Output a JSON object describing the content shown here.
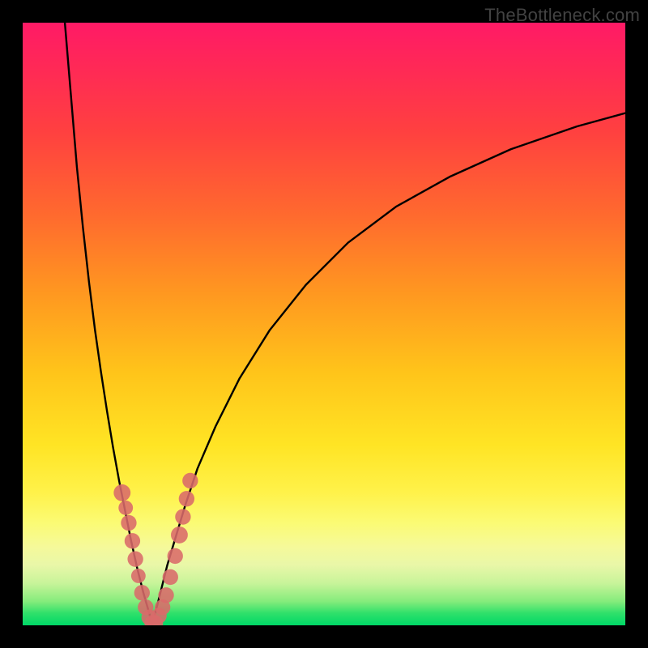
{
  "watermark": "TheBottleneck.com",
  "chart_data": {
    "type": "line",
    "title": "",
    "xlabel": "",
    "ylabel": "",
    "xlim": [
      0,
      100
    ],
    "ylim": [
      0,
      100
    ],
    "grid": false,
    "legend": false,
    "series": [
      {
        "name": "left-curve",
        "x": [
          7,
          8,
          9,
          10,
          11,
          12,
          13,
          14,
          15,
          16,
          17,
          18,
          19,
          20,
          21,
          21.5
        ],
        "values": [
          100,
          88,
          76,
          66,
          57,
          49,
          42,
          35.5,
          29.5,
          24,
          19,
          14,
          9.5,
          5.5,
          2,
          0
        ]
      },
      {
        "name": "right-curve",
        "x": [
          21.5,
          22,
          23,
          24,
          25.5,
          27,
          29,
          32,
          36,
          41,
          47,
          54,
          62,
          71,
          81,
          92,
          100
        ],
        "values": [
          0,
          2,
          6,
          10,
          15,
          20,
          26,
          33,
          41,
          49,
          56.5,
          63.5,
          69.5,
          74.5,
          79,
          82.8,
          85
        ]
      }
    ],
    "markers": {
      "name": "highlighted-points",
      "points": [
        {
          "x": 16.5,
          "y": 22,
          "r": 1.4
        },
        {
          "x": 17.1,
          "y": 19.5,
          "r": 1.2
        },
        {
          "x": 17.6,
          "y": 17,
          "r": 1.3
        },
        {
          "x": 18.2,
          "y": 14,
          "r": 1.3
        },
        {
          "x": 18.7,
          "y": 11,
          "r": 1.3
        },
        {
          "x": 19.2,
          "y": 8.2,
          "r": 1.2
        },
        {
          "x": 19.8,
          "y": 5.4,
          "r": 1.3
        },
        {
          "x": 20.4,
          "y": 3.0,
          "r": 1.3
        },
        {
          "x": 21.0,
          "y": 1.3,
          "r": 1.3
        },
        {
          "x": 21.5,
          "y": 0.4,
          "r": 1.3
        },
        {
          "x": 22.0,
          "y": 0.4,
          "r": 1.3
        },
        {
          "x": 22.6,
          "y": 1.6,
          "r": 1.3
        },
        {
          "x": 23.2,
          "y": 3.0,
          "r": 1.3
        },
        {
          "x": 23.8,
          "y": 5.0,
          "r": 1.3
        },
        {
          "x": 24.5,
          "y": 8.0,
          "r": 1.3
        },
        {
          "x": 25.3,
          "y": 11.5,
          "r": 1.3
        },
        {
          "x": 26.0,
          "y": 15.0,
          "r": 1.4
        },
        {
          "x": 26.6,
          "y": 18.0,
          "r": 1.3
        },
        {
          "x": 27.2,
          "y": 21.0,
          "r": 1.3
        },
        {
          "x": 27.8,
          "y": 24.0,
          "r": 1.3
        }
      ]
    },
    "background_gradient": {
      "stops": [
        {
          "pos": 0.0,
          "color": "#ff1a66"
        },
        {
          "pos": 0.18,
          "color": "#ff4040"
        },
        {
          "pos": 0.45,
          "color": "#ff9820"
        },
        {
          "pos": 0.7,
          "color": "#ffe424"
        },
        {
          "pos": 0.87,
          "color": "#f5f99a"
        },
        {
          "pos": 1.0,
          "color": "#00d867"
        }
      ]
    }
  }
}
